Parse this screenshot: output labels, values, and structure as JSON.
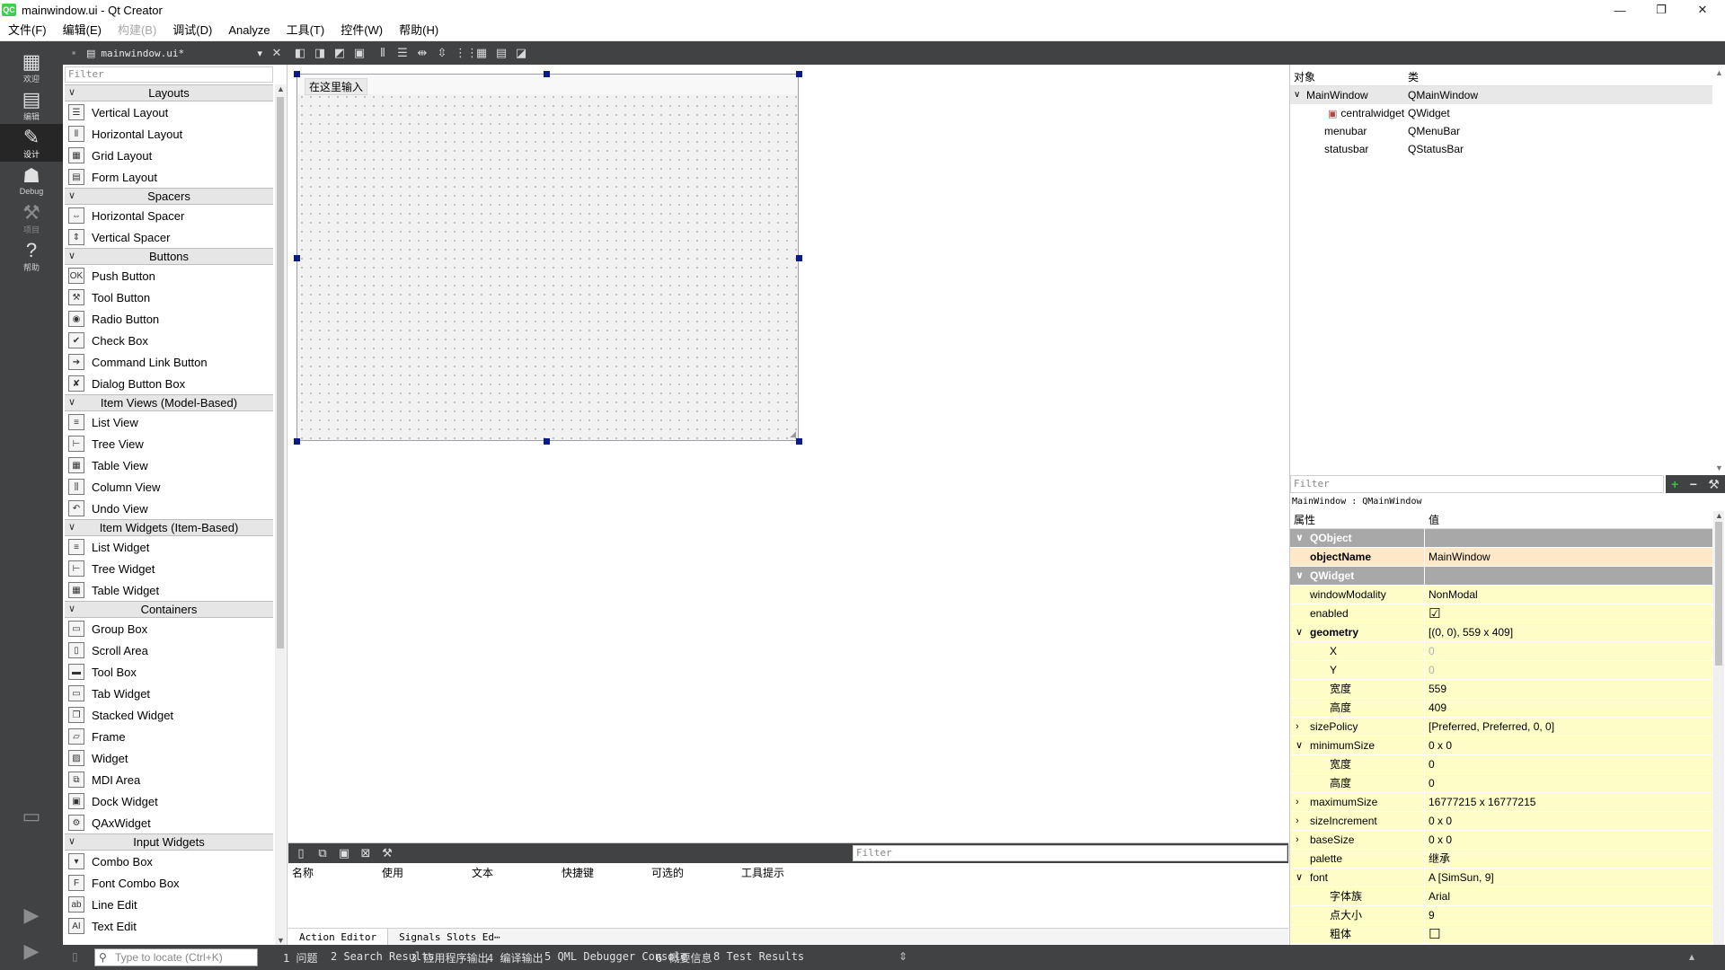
{
  "window": {
    "title": "mainwindow.ui - Qt Creator",
    "app_icon_text": "QC",
    "minimize": "—",
    "restore": "❐",
    "close": "✕"
  },
  "menu": [
    "文件(F)",
    "编辑(E)",
    "构建(B)",
    "调试(D)",
    "Analyze",
    "工具(T)",
    "控件(W)",
    "帮助(H)"
  ],
  "menu_disabled_index": 2,
  "modes": [
    {
      "icon": "grid-icon",
      "glyph": "▦",
      "label": "欢迎"
    },
    {
      "icon": "edit-doc-icon",
      "glyph": "▤",
      "label": "编辑"
    },
    {
      "icon": "pencil-icon",
      "glyph": "✎",
      "label": "设计"
    },
    {
      "icon": "bug-icon",
      "glyph": "☗",
      "label": "Debug"
    },
    {
      "icon": "wrench-icon",
      "glyph": "⚒",
      "label": "项目"
    },
    {
      "icon": "help-icon",
      "glyph": "?",
      "label": "帮助"
    }
  ],
  "document": {
    "name": "mainwindow.ui*"
  },
  "widget_box": {
    "filter_placeholder": "Filter",
    "categories": [
      {
        "name": "Layouts",
        "items": [
          "Vertical Layout",
          "Horizontal Layout",
          "Grid Layout",
          "Form Layout"
        ]
      },
      {
        "name": "Spacers",
        "items": [
          "Horizontal Spacer",
          "Vertical Spacer"
        ]
      },
      {
        "name": "Buttons",
        "items": [
          "Push Button",
          "Tool Button",
          "Radio Button",
          "Check Box",
          "Command Link Button",
          "Dialog Button Box"
        ]
      },
      {
        "name": "Item Views (Model-Based)",
        "items": [
          "List View",
          "Tree View",
          "Table View",
          "Column View",
          "Undo View"
        ]
      },
      {
        "name": "Item Widgets (Item-Based)",
        "items": [
          "List Widget",
          "Tree Widget",
          "Table Widget"
        ]
      },
      {
        "name": "Containers",
        "items": [
          "Group Box",
          "Scroll Area",
          "Tool Box",
          "Tab Widget",
          "Stacked Widget",
          "Frame",
          "Widget",
          "MDI Area",
          "Dock Widget",
          "QAxWidget"
        ]
      },
      {
        "name": "Input Widgets",
        "items": [
          "Combo Box",
          "Font Combo Box",
          "Line Edit",
          "Text Edit"
        ]
      }
    ]
  },
  "form": {
    "menu_placeholder": "在这里输入"
  },
  "action_editor": {
    "filter_placeholder": "Filter",
    "columns": [
      "名称",
      "使用",
      "文本",
      "快捷键",
      "可选的",
      "工具提示"
    ],
    "tabs": [
      "Action Editor",
      "Signals Slots Ed⋯"
    ]
  },
  "object_inspector": {
    "header": [
      "对象",
      "类"
    ],
    "rows": [
      {
        "name": "MainWindow",
        "cls": "QMainWindow",
        "indent": 0,
        "expanded": true
      },
      {
        "name": "centralwidget",
        "cls": "QWidget",
        "indent": 1,
        "icon": true
      },
      {
        "name": "menubar",
        "cls": "QMenuBar",
        "indent": 1
      },
      {
        "name": "statusbar",
        "cls": "QStatusBar",
        "indent": 1
      }
    ]
  },
  "property_editor": {
    "filter_placeholder": "Filter",
    "class_label": "MainWindow : QMainWindow",
    "header": [
      "属性",
      "值"
    ],
    "rows": [
      {
        "name": "QObject",
        "value": "",
        "kind": "group"
      },
      {
        "name": "objectName",
        "value": "MainWindow",
        "kind": "obj",
        "bold": true
      },
      {
        "name": "QWidget",
        "value": "",
        "kind": "group"
      },
      {
        "name": "windowModality",
        "value": "NonModal",
        "kind": "wid"
      },
      {
        "name": "enabled",
        "value": "☑",
        "kind": "wid",
        "check": true
      },
      {
        "name": "geometry",
        "value": "[(0, 0), 559 x 409]",
        "kind": "wid",
        "bold": true,
        "expand": "v"
      },
      {
        "name": "X",
        "value": "0",
        "kind": "wid",
        "sub": true,
        "grey": true
      },
      {
        "name": "Y",
        "value": "0",
        "kind": "wid",
        "sub": true,
        "grey": true
      },
      {
        "name": "宽度",
        "value": "559",
        "kind": "wid",
        "sub": true
      },
      {
        "name": "高度",
        "value": "409",
        "kind": "wid",
        "sub": true
      },
      {
        "name": "sizePolicy",
        "value": "[Preferred, Preferred, 0, 0]",
        "kind": "wid",
        "expand": ">"
      },
      {
        "name": "minimumSize",
        "value": "0 x 0",
        "kind": "wid",
        "expand": "v"
      },
      {
        "name": "宽度",
        "value": "0",
        "kind": "wid",
        "sub": true
      },
      {
        "name": "高度",
        "value": "0",
        "kind": "wid",
        "sub": true
      },
      {
        "name": "maximumSize",
        "value": "16777215 x 16777215",
        "kind": "wid",
        "expand": ">"
      },
      {
        "name": "sizeIncrement",
        "value": "0 x 0",
        "kind": "wid",
        "expand": ">"
      },
      {
        "name": "baseSize",
        "value": "0 x 0",
        "kind": "wid",
        "expand": ">"
      },
      {
        "name": "palette",
        "value": "继承",
        "kind": "wid"
      },
      {
        "name": "font",
        "value": "A  [SimSun, 9]",
        "kind": "wid",
        "expand": "v"
      },
      {
        "name": "字体族",
        "value": "Arial",
        "kind": "wid",
        "sub": true
      },
      {
        "name": "点大小",
        "value": "9",
        "kind": "wid",
        "sub": true
      },
      {
        "name": "粗体",
        "value": "☐",
        "kind": "wid",
        "sub": true,
        "check": true
      }
    ]
  },
  "statusbar": {
    "locator_placeholder": "Type to locate (Ctrl+K)",
    "tabs": [
      "1 问题",
      "2 Search Results",
      "3 应用程序输出",
      "4 编译输出",
      "5 QML Debugger Console",
      "6 概要信息",
      "8 Test Results"
    ]
  },
  "colors": {
    "sidebar": "#404244",
    "selection_handle": "#0b1a8a",
    "group_row": "#a8a8a8",
    "object_row": "#fde9c8",
    "widget_row": "#fefdc8",
    "add_button": "#3fbf3f"
  }
}
